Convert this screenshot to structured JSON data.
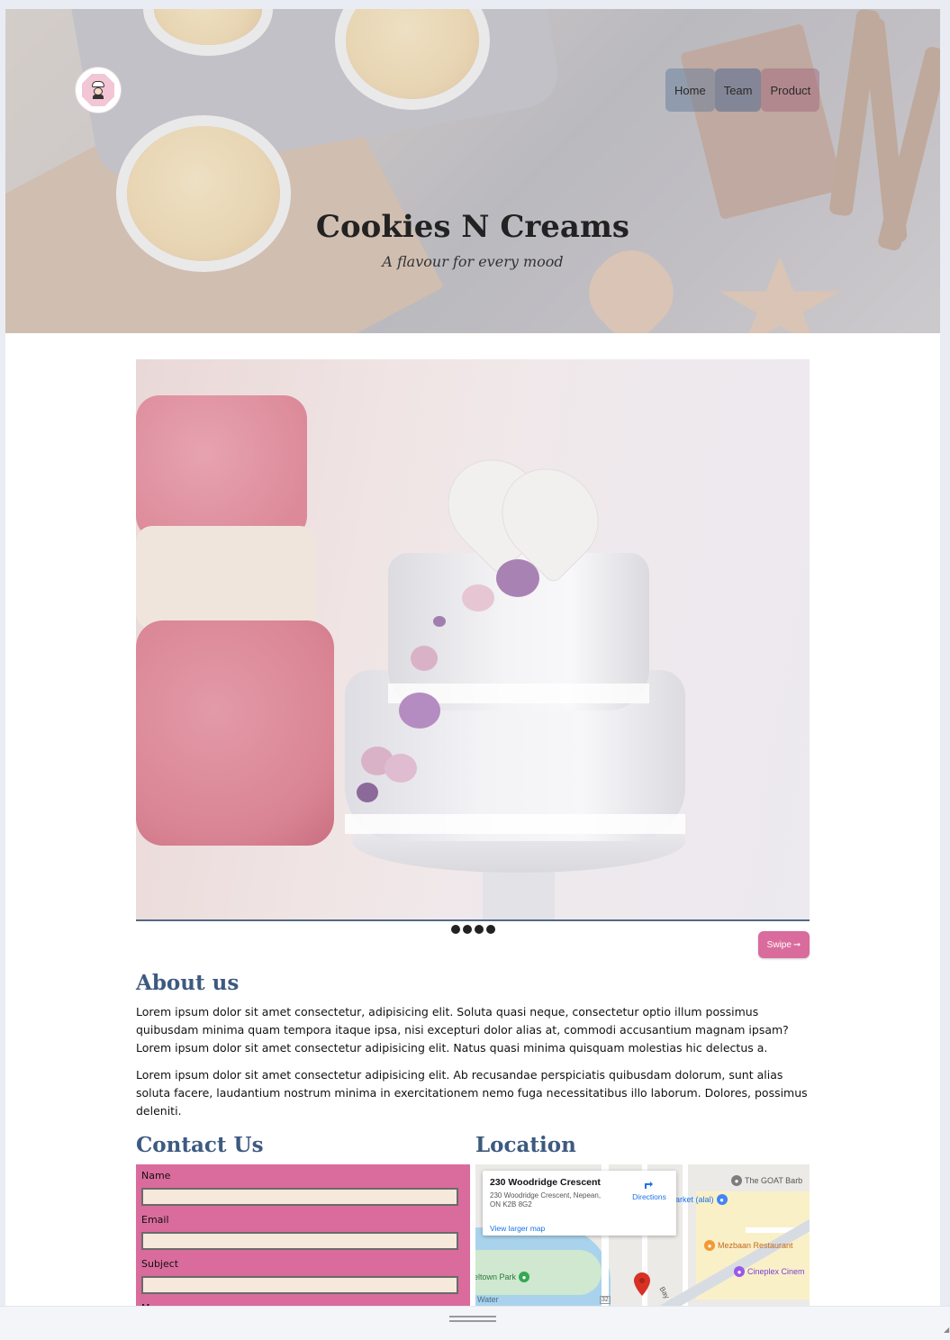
{
  "header": {
    "nav": [
      {
        "label": "Home"
      },
      {
        "label": "Team"
      },
      {
        "label": "Product"
      }
    ],
    "title": "Cookies N Creams",
    "tagline": "A flavour for every mood"
  },
  "carousel": {
    "dots": 4,
    "swipe_label": "Swipe"
  },
  "about": {
    "heading": "About us",
    "paragraphs": [
      "Lorem ipsum dolor sit amet consectetur, adipisicing elit. Soluta quasi neque, consectetur optio illum possimus quibusdam minima quam tempora itaque ipsa, nisi excepturi dolor alias at, commodi accusantium magnam ipsam? Lorem ipsum dolor sit amet consectetur adipisicing elit. Natus quasi minima quisquam molestias hic delectus a.",
      "Lorem ipsum dolor sit amet consectetur adipisicing elit. Ab recusandae perspiciatis quibusdam dolorum, sunt alias soluta facere, laudantium nostrum minima in exercitationem nemo fuga necessitatibus illo laborum. Dolores, possimus deleniti."
    ]
  },
  "contact": {
    "heading": "Contact Us",
    "fields": [
      {
        "label": "Name",
        "value": ""
      },
      {
        "label": "Email",
        "value": ""
      },
      {
        "label": "Subject",
        "value": ""
      },
      {
        "label": "Message",
        "value": ""
      }
    ]
  },
  "location": {
    "heading": "Location",
    "map": {
      "card_title": "230 Woodridge Crescent",
      "card_address": "230 Woodridge Crescent, Nepean, ON K2B 8G2",
      "directions_label": "Directions",
      "larger_map_label": "View larger map",
      "pois": {
        "goat": "The GOAT Barb",
        "market": "arket (alal)",
        "mezbaan": "Mezbaan Restaurant",
        "cineplex": "Cineplex Cinem",
        "park": "eltown Park",
        "water": "Water"
      },
      "street_labels": [
        "Bay",
        "32"
      ]
    }
  },
  "colors": {
    "accent_pink": "#d96c9c",
    "heading_blue": "#3d5a80",
    "input_bg": "#f6e9dc"
  }
}
